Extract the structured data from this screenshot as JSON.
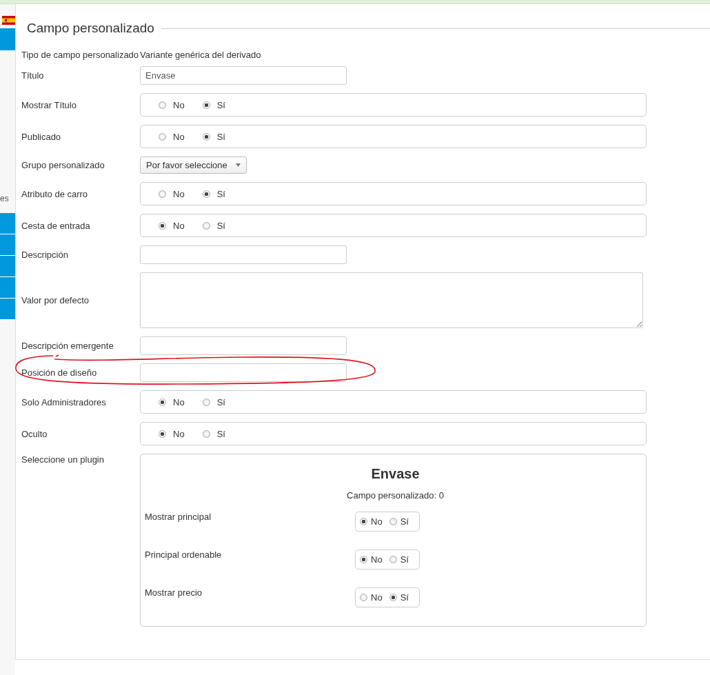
{
  "sidebar": {
    "text_fragment": "es"
  },
  "panel": {
    "legend": "Campo personalizado"
  },
  "fields": [
    {
      "kind": "text",
      "label": "Tipo de campo personalizado",
      "value": "Variante genérica del derivado"
    },
    {
      "kind": "input",
      "label": "Título",
      "value": "Envase"
    },
    {
      "kind": "radio",
      "label": "Mostrar Título",
      "options": [
        {
          "label": "No",
          "selected": false
        },
        {
          "label": "Sí",
          "selected": true
        }
      ]
    },
    {
      "kind": "radio",
      "label": "Publicado",
      "options": [
        {
          "label": "No",
          "selected": false
        },
        {
          "label": "Sí",
          "selected": true
        }
      ]
    },
    {
      "kind": "select",
      "label": "Grupo personalizado",
      "value": "Por favor seleccione"
    },
    {
      "kind": "radio",
      "label": "Atributo de carro",
      "options": [
        {
          "label": "No",
          "selected": false
        },
        {
          "label": "Sí",
          "selected": true
        }
      ]
    },
    {
      "kind": "radio",
      "label": "Cesta de entrada",
      "options": [
        {
          "label": "No",
          "selected": true
        },
        {
          "label": "Sí",
          "selected": false
        }
      ]
    },
    {
      "kind": "input",
      "label": "Descripción"
    },
    {
      "kind": "textarea",
      "label": "Valor por defecto"
    },
    {
      "kind": "input",
      "label": "Descripción emergente"
    },
    {
      "kind": "input",
      "label": "Posición de diseño",
      "highlighted": true
    },
    {
      "kind": "radio",
      "label": "Solo Administradores",
      "options": [
        {
          "label": "No",
          "selected": true
        },
        {
          "label": "Sí",
          "selected": false
        }
      ]
    },
    {
      "kind": "radio",
      "label": "Oculto",
      "options": [
        {
          "label": "No",
          "selected": true
        },
        {
          "label": "Sí",
          "selected": false
        }
      ]
    },
    {
      "kind": "plugin",
      "label": "Seleccione un plugin",
      "title": "Envase",
      "subtitle": "Campo personalizado: 0",
      "options": [
        {
          "label": "Mostrar principal",
          "choices": [
            {
              "label": "No",
              "selected": true
            },
            {
              "label": "Sí",
              "selected": false
            }
          ]
        },
        {
          "label": "Principal ordenable",
          "choices": [
            {
              "label": "No",
              "selected": true
            },
            {
              "label": "Sí",
              "selected": false
            }
          ]
        },
        {
          "label": "Mostrar precio",
          "choices": [
            {
              "label": "No",
              "selected": false
            },
            {
              "label": "Sí",
              "selected": true
            }
          ]
        }
      ]
    }
  ]
}
